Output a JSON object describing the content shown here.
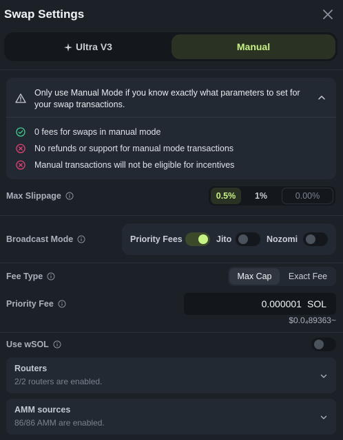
{
  "title": "Swap Settings",
  "modes": [
    {
      "label": "Ultra V3",
      "icon": "sparkle-icon"
    },
    {
      "label": "Manual",
      "active": true
    }
  ],
  "warning": {
    "text": "Only use Manual Mode if you know exactly what parameters to set for your swap transactions.",
    "notes": [
      {
        "text": "0 fees for swaps in manual mode",
        "icon": "check-circle-icon",
        "color": "#3ecf8e"
      },
      {
        "text": "No refunds or support for manual mode transactions",
        "icon": "x-circle-icon",
        "color": "#e5427a"
      },
      {
        "text": "Manual transactions will not be eligible for incentives",
        "icon": "x-circle-icon",
        "color": "#e5427a"
      }
    ]
  },
  "max_slippage": {
    "label": "Max Slippage",
    "options": [
      "0.5%",
      "1%"
    ],
    "selected": "0.5%",
    "custom_placeholder": "0.00%"
  },
  "broadcast_mode": {
    "label": "Broadcast Mode",
    "options": [
      {
        "label": "Priority Fees",
        "enabled": true
      },
      {
        "label": "Jito",
        "enabled": false
      },
      {
        "label": "Nozomi",
        "enabled": false
      }
    ]
  },
  "fee_type": {
    "label": "Fee Type",
    "options": [
      "Max Cap",
      "Exact Fee"
    ],
    "selected": "Max Cap"
  },
  "priority_fee": {
    "label": "Priority Fee",
    "value": "0.000001",
    "unit": "SOL",
    "usd": "$0.0₄89363~"
  },
  "use_wsol": {
    "label": "Use wSOL",
    "enabled": false
  },
  "routers": {
    "title": "Routers",
    "subtitle": "2/2 routers are enabled."
  },
  "amm_sources": {
    "title": "AMM sources",
    "subtitle": "86/86 AMM are enabled."
  },
  "colors": {
    "accent": "#c7f284",
    "background": "#1c2128",
    "panel": "#232932"
  }
}
